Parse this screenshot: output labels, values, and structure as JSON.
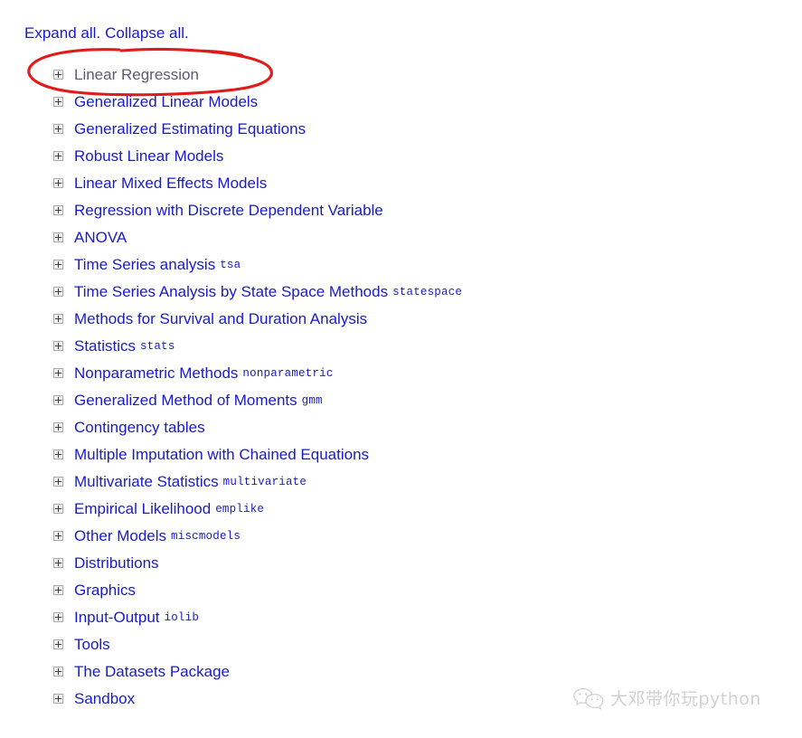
{
  "controls": {
    "expand_all": "Expand all.",
    "collapse_all": "Collapse all."
  },
  "colors": {
    "link": "#1a1acd",
    "visited_link": "#5b5b74",
    "annotation": "#e01b1b",
    "watermark": "#9a9a9a",
    "background": "#ffffff"
  },
  "toctree": {
    "expander_icon": "plus-box-icon",
    "items": [
      {
        "label": "Linear Regression",
        "module": "",
        "visited": true
      },
      {
        "label": "Generalized Linear Models",
        "module": "",
        "visited": false
      },
      {
        "label": "Generalized Estimating Equations",
        "module": "",
        "visited": false
      },
      {
        "label": "Robust Linear Models",
        "module": "",
        "visited": false
      },
      {
        "label": "Linear Mixed Effects Models",
        "module": "",
        "visited": false
      },
      {
        "label": "Regression with Discrete Dependent Variable",
        "module": "",
        "visited": false
      },
      {
        "label": "ANOVA",
        "module": "",
        "visited": false
      },
      {
        "label": "Time Series analysis",
        "module": "tsa",
        "visited": false
      },
      {
        "label": "Time Series Analysis by State Space Methods",
        "module": "statespace",
        "visited": false
      },
      {
        "label": "Methods for Survival and Duration Analysis",
        "module": "",
        "visited": false
      },
      {
        "label": "Statistics",
        "module": "stats",
        "visited": false
      },
      {
        "label": "Nonparametric Methods",
        "module": "nonparametric",
        "visited": false
      },
      {
        "label": "Generalized Method of Moments",
        "module": "gmm",
        "visited": false
      },
      {
        "label": "Contingency tables",
        "module": "",
        "visited": false
      },
      {
        "label": "Multiple Imputation with Chained Equations",
        "module": "",
        "visited": false
      },
      {
        "label": "Multivariate Statistics",
        "module": "multivariate",
        "visited": false
      },
      {
        "label": "Empirical Likelihood",
        "module": "emplike",
        "visited": false
      },
      {
        "label": "Other Models",
        "module": "miscmodels",
        "visited": false
      },
      {
        "label": "Distributions",
        "module": "",
        "visited": false
      },
      {
        "label": "Graphics",
        "module": "",
        "visited": false
      },
      {
        "label": "Input-Output",
        "module": "iolib",
        "visited": false
      },
      {
        "label": "Tools",
        "module": "",
        "visited": false
      },
      {
        "label": "The Datasets Package",
        "module": "",
        "visited": false
      },
      {
        "label": "Sandbox",
        "module": "",
        "visited": false
      }
    ]
  },
  "annotation": {
    "shape": "hand-drawn-red-ellipse",
    "targets": "Linear Regression"
  },
  "watermark": {
    "icon": "wechat-icon",
    "text": "大邓带你玩python"
  }
}
